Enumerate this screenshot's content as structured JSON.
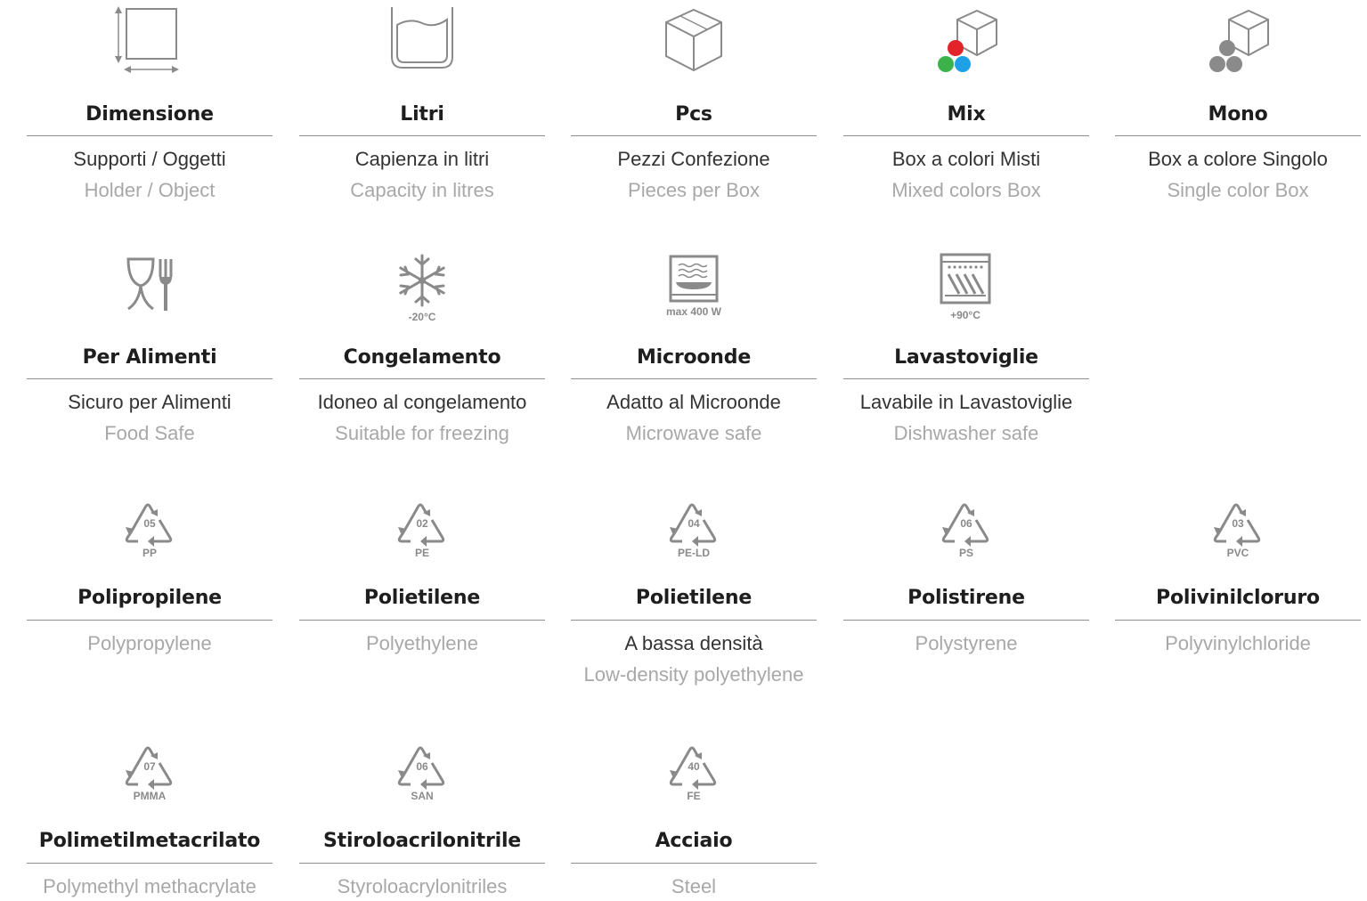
{
  "row1": {
    "dimensione": {
      "title": "Dimensione",
      "it": "Supporti / Oggetti",
      "en": "Holder / Object",
      "icon": "dimension-icon"
    },
    "litri": {
      "title": "Litri",
      "it": "Capienza in litri",
      "en": "Capacity in litres",
      "icon": "liters-container-icon"
    },
    "pcs": {
      "title": "Pcs",
      "it": "Pezzi Confezione",
      "en": "Pieces per Box",
      "icon": "box-icon"
    },
    "mix": {
      "title": "Mix",
      "it": "Box a colori Misti",
      "en": "Mixed colors Box",
      "icon": "mixed-colors-box-icon"
    },
    "mono": {
      "title": "Mono",
      "it": "Box a colore Singolo",
      "en": "Single color Box",
      "icon": "single-color-box-icon"
    }
  },
  "row2": {
    "alimenti": {
      "title": "Per Alimenti",
      "it": "Sicuro per Alimenti",
      "en": "Food Safe",
      "icon": "food-safe-icon"
    },
    "congelamento": {
      "title": "Congelamento",
      "it": "Idoneo al congelamento",
      "en": "Suitable for freezing",
      "icon_label": "-20°C",
      "icon": "snowflake-icon"
    },
    "microonde": {
      "title": "Microonde",
      "it": "Adatto al Microonde",
      "en": "Microwave safe",
      "icon_label": "max 400 W",
      "icon": "microwave-icon"
    },
    "lavastoviglie": {
      "title": "Lavastoviglie",
      "it": "Lavabile in Lavastoviglie",
      "en": "Dishwasher safe",
      "icon_label": "+90°C",
      "icon": "dishwasher-icon"
    }
  },
  "row3": {
    "pp": {
      "title": "Polipropilene",
      "en": "Polypropylene",
      "code": "05",
      "abbr": "PP",
      "icon": "recycle-icon"
    },
    "pe": {
      "title": "Polietilene",
      "en": "Polyethylene",
      "code": "02",
      "abbr": "PE",
      "icon": "recycle-icon"
    },
    "peld": {
      "title": "Polietilene",
      "it": "A bassa densità",
      "en": "Low-density polyethylene",
      "code": "04",
      "abbr": "PE-LD",
      "icon": "recycle-icon"
    },
    "ps": {
      "title": "Polistirene",
      "en": "Polystyrene",
      "code": "06",
      "abbr": "PS",
      "icon": "recycle-icon"
    },
    "pvc": {
      "title": "Polivinilcloruro",
      "en": "Polyvinylchloride",
      "code": "03",
      "abbr": "PVC",
      "icon": "recycle-icon"
    }
  },
  "row4": {
    "pmma": {
      "title": "Polimetilmetacrilato",
      "en": "Polymethyl methacrylate",
      "code": "07",
      "abbr": "PMMA",
      "icon": "recycle-icon"
    },
    "san": {
      "title": "Stiroloacrilonitrile",
      "en": "Styroloacrylonitriles",
      "code": "06",
      "abbr": "SAN",
      "icon": "recycle-icon"
    },
    "fe": {
      "title": "Acciaio",
      "en": "Steel",
      "code": "40",
      "abbr": "FE",
      "icon": "recycle-icon"
    }
  },
  "colors": {
    "icon_gray": "#8a8a8a",
    "rule": "#8e8e8e",
    "red": "#e2232a",
    "green": "#3cb34a",
    "blue": "#1ea0e6"
  }
}
